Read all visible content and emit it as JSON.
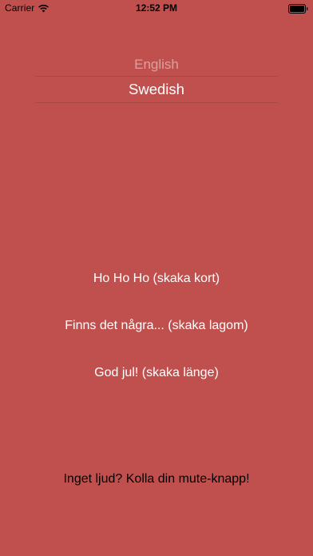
{
  "status_bar": {
    "carrier": "Carrier",
    "time": "12:52 PM",
    "wifi_icon": "wifi-icon",
    "battery_icon": "battery-icon"
  },
  "language_picker": {
    "options": [
      "English",
      "Swedish"
    ],
    "selected": "Swedish"
  },
  "sound_buttons": {
    "short": "Ho Ho Ho (skaka kort)",
    "medium": "Finns det några... (skaka lagom)",
    "long": "God jul! (skaka länge)"
  },
  "mute_hint": "Inget ljud? Kolla din mute-knapp!",
  "colors": {
    "background": "#c0504d",
    "text": "#ffffff",
    "hint_text": "#000000"
  }
}
